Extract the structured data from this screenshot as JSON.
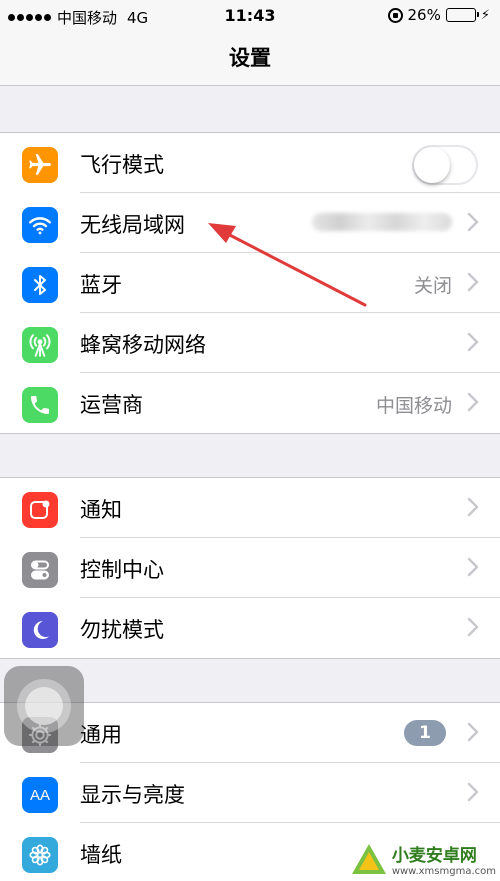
{
  "status": {
    "carrier": "中国移动",
    "network": "4G",
    "time": "11:43",
    "battery_percent": "26%",
    "battery_level": 0.26
  },
  "nav": {
    "title": "设置"
  },
  "group1": [
    {
      "label": "飞行模式",
      "icon": "airplane-icon",
      "color": "#ff9500",
      "toggle_on": false
    },
    {
      "label": "无线局域网",
      "icon": "wifi-icon",
      "color": "#007aff",
      "value": ""
    },
    {
      "label": "蓝牙",
      "icon": "bluetooth-icon",
      "color": "#007aff",
      "value": "关闭"
    },
    {
      "label": "蜂窝移动网络",
      "icon": "cellular-antenna-icon",
      "color": "#4cd964"
    },
    {
      "label": "运营商",
      "icon": "phone-icon",
      "color": "#4cd964",
      "value": "中国移动"
    }
  ],
  "group2": [
    {
      "label": "通知",
      "icon": "notifications-icon",
      "color": "#ff3b30"
    },
    {
      "label": "控制中心",
      "icon": "control-center-icon",
      "color": "#8e8e93"
    },
    {
      "label": "勿扰模式",
      "icon": "moon-icon",
      "color": "#5856d6"
    }
  ],
  "group3": [
    {
      "label": "通用",
      "icon": "gear-icon",
      "color": "#8e8e93",
      "badge": "1"
    },
    {
      "label": "显示与亮度",
      "icon": "text-size-icon",
      "color": "#007aff",
      "icon_text": "AA"
    },
    {
      "label": "墙纸",
      "icon": "flower-icon",
      "color": "#34aadc"
    }
  ],
  "watermark": {
    "text": "小麦安卓网",
    "url": "www.xmsmgma.com"
  }
}
